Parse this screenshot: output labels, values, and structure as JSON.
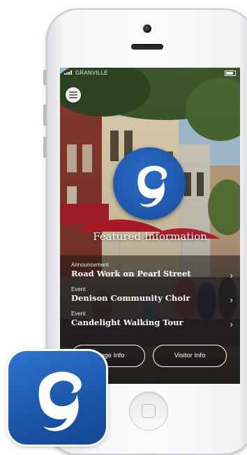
{
  "status_bar": {
    "carrier": "GRANVILLE"
  },
  "screen": {
    "featured_title": "Featured Information",
    "items": [
      {
        "kind": "Announcement",
        "title": "Road Work on Pearl Street"
      },
      {
        "kind": "Event",
        "title": "Denison Community Choir"
      },
      {
        "kind": "Event",
        "title": "Candelight Walking Tour"
      }
    ],
    "buttons": {
      "village_info": "Village Info",
      "visitor_info": "Visitor Info"
    }
  },
  "icons": {
    "menu": "hamburger-menu-icon",
    "chevron": "chevron-right-icon",
    "logo": "granville-g-logo",
    "app": "granville-app-icon"
  },
  "colors": {
    "brand_blue": "#1d56a8",
    "overlay": "#1c1818"
  }
}
